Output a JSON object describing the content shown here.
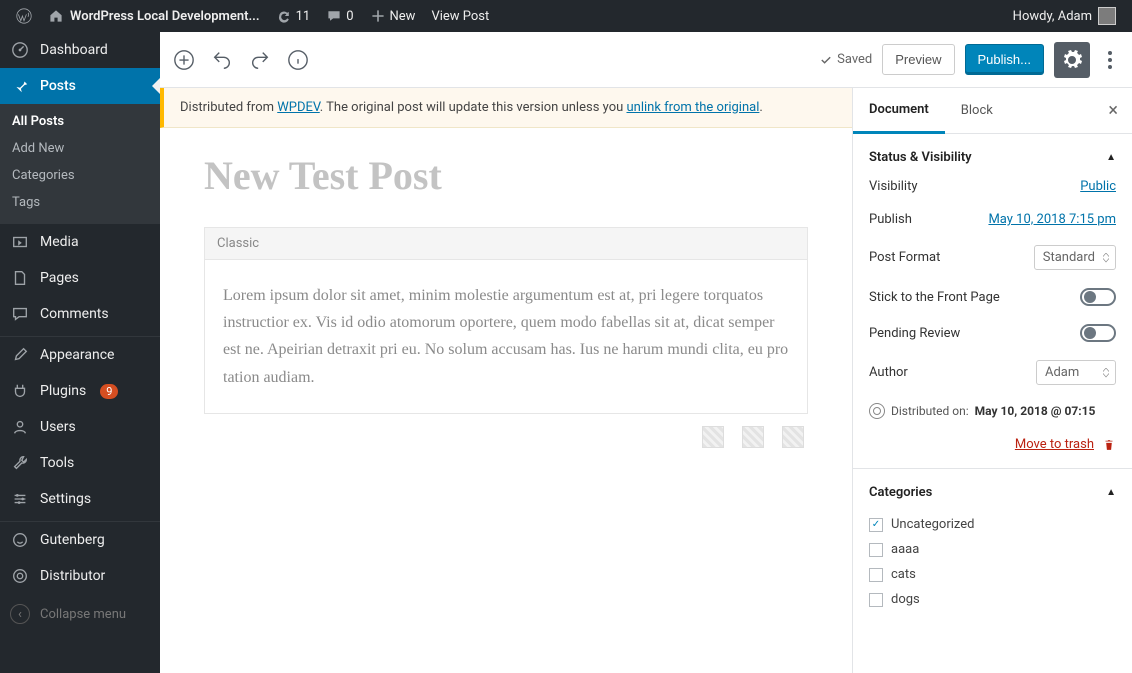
{
  "adminbar": {
    "site_title": "WordPress Local Development...",
    "updates": "11",
    "comments": "0",
    "new_label": "New",
    "view_post": "View Post",
    "howdy": "Howdy, Adam"
  },
  "sidebar": {
    "dashboard": "Dashboard",
    "posts": "Posts",
    "posts_sub": [
      "All Posts",
      "Add New",
      "Categories",
      "Tags"
    ],
    "media": "Media",
    "pages": "Pages",
    "comments": "Comments",
    "appearance": "Appearance",
    "plugins": "Plugins",
    "plugins_count": "9",
    "users": "Users",
    "tools": "Tools",
    "settings": "Settings",
    "gutenberg": "Gutenberg",
    "distributor": "Distributor",
    "collapse": "Collapse menu"
  },
  "toolbar": {
    "saved": "Saved",
    "preview": "Preview",
    "publish": "Publish..."
  },
  "notice": {
    "prefix": "Distributed from ",
    "site": "WPDEV",
    "middle": ". The original post will update this version unless you ",
    "link": "unlink from the original",
    "suffix": "."
  },
  "editor": {
    "title": "New Test Post",
    "block_label": "Classic",
    "body": "Lorem ipsum dolor sit amet, minim molestie argumentum est at, pri legere torquatos instructior ex. Vis id odio atomorum oportere, quem modo fabellas sit at, dicat semper est ne. Apeirian detraxit pri eu. No solum accusam has. Ius ne harum mundi clita, eu pro tation audiam."
  },
  "settings": {
    "tabs": {
      "document": "Document",
      "block": "Block"
    },
    "status_visibility": {
      "title": "Status & Visibility",
      "visibility_label": "Visibility",
      "visibility_value": "Public",
      "publish_label": "Publish",
      "publish_value": "May 10, 2018 7:15 pm",
      "post_format_label": "Post Format",
      "post_format_value": "Standard",
      "stick_label": "Stick to the Front Page",
      "pending_label": "Pending Review",
      "author_label": "Author",
      "author_value": "Adam",
      "distributed_label": "Distributed on:",
      "distributed_value": "May 10, 2018 @ 07:15",
      "trash": "Move to trash"
    },
    "categories": {
      "title": "Categories",
      "items": [
        {
          "label": "Uncategorized",
          "checked": true
        },
        {
          "label": "aaaa",
          "checked": false
        },
        {
          "label": "cats",
          "checked": false
        },
        {
          "label": "dogs",
          "checked": false
        }
      ]
    }
  }
}
